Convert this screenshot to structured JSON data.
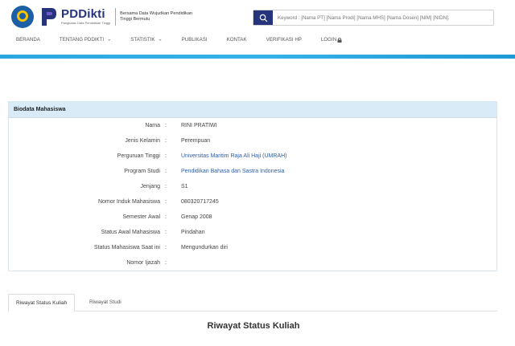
{
  "header": {
    "brand_name": "PDDikti",
    "brand_sub": "Pangkalan Data Pendidikan Tinggi",
    "tagline": "Bersama Data Wujudkan Pendidikan Tinggi Bermutu",
    "search_placeholder": "Keyword : [Nama PT] [Nama Prodi] [Nama MHS] [Nama Dosen] [NIM] [NIDN].",
    "accent_color": "#27337a",
    "bar_color": "#2aa7dd"
  },
  "nav": {
    "items": [
      {
        "label": "BERANDA",
        "dropdown": false
      },
      {
        "label": "TENTANG PDDIKTI",
        "dropdown": true
      },
      {
        "label": "STATISTIK",
        "dropdown": true
      },
      {
        "label": "PUBLIKASI",
        "dropdown": false
      },
      {
        "label": "KONTAK",
        "dropdown": false
      },
      {
        "label": "VERIFIKASI HP",
        "dropdown": false
      },
      {
        "label": "LOGIN",
        "dropdown": false,
        "icon": "lock-icon"
      }
    ]
  },
  "biodata": {
    "title": "Biodata Mahasiswa",
    "rows": [
      {
        "label": "Nama",
        "value": "RINI PRATIWI",
        "link": false
      },
      {
        "label": "Jenis Kelamin",
        "value": "Perempuan",
        "link": false
      },
      {
        "label": "Perguruan Tinggi",
        "value": "Universitas Maritim Raja Ali Haji (UMRAH)",
        "link": true
      },
      {
        "label": "Program Studi",
        "value": "Pendidikan Bahasa dan Sastra Indonesia",
        "link": true
      },
      {
        "label": "Jenjang",
        "value": "S1",
        "link": false
      },
      {
        "label": "Nomor Induk Mahasiswa",
        "value": "080320717245",
        "link": false
      },
      {
        "label": "Semester Awal",
        "value": "Genap 2008",
        "link": false
      },
      {
        "label": "Status Awal Mahasiswa",
        "value": "Pindahan",
        "link": false
      },
      {
        "label": "Status Mahasiswa Saat ini",
        "value": "Mengundurkan diri",
        "link": false
      },
      {
        "label": "Nomor Ijazah",
        "value": "",
        "link": false
      }
    ]
  },
  "tabs": [
    {
      "label": "Riwayat Status Kuliah",
      "active": true
    },
    {
      "label": "Riwayat Studi",
      "active": false
    }
  ],
  "section_title": "Riwayat Status Kuliah"
}
